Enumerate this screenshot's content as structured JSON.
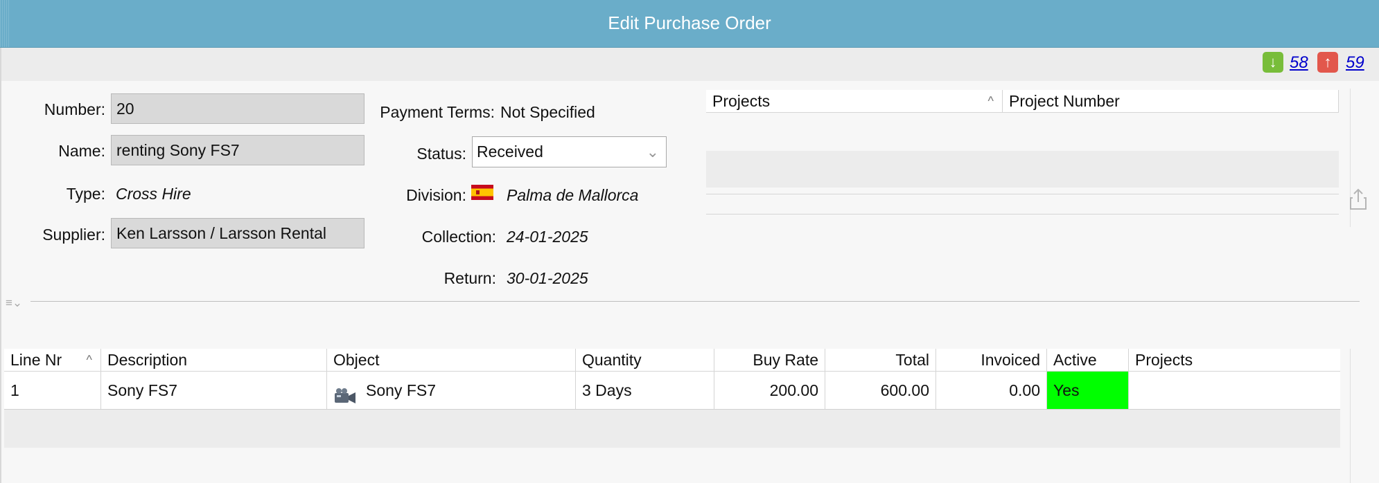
{
  "window": {
    "title": "Edit Purchase Order"
  },
  "nav": {
    "prev_label": "58",
    "next_label": "59"
  },
  "form": {
    "number_label": "Number:",
    "number_value": "20",
    "name_label": "Name:",
    "name_value": "renting Sony FS7",
    "type_label": "Type:",
    "type_value": "Cross Hire",
    "supplier_label": "Supplier:",
    "supplier_value": "Ken Larsson / Larsson Rental",
    "payment_terms_label": "Payment Terms:",
    "payment_terms_value": "Not Specified",
    "status_label": "Status:",
    "status_value": "Received",
    "division_label": "Division:",
    "division_value": "Palma de Mallorca",
    "collection_label": "Collection:",
    "collection_value": "24-01-2025",
    "return_label": "Return:",
    "return_value": "30-01-2025"
  },
  "projects_table": {
    "columns": [
      "Projects",
      "Project Number"
    ]
  },
  "lines_table": {
    "columns": [
      "Line Nr",
      "Description",
      "Object",
      "Quantity",
      "Buy Rate",
      "Total",
      "Invoiced",
      "Active",
      "Projects"
    ],
    "rows": [
      {
        "line_nr": "1",
        "description": "Sony FS7",
        "object": "Sony FS7",
        "quantity": "3 Days",
        "buy_rate": "200.00",
        "total": "600.00",
        "invoiced": "0.00",
        "active": "Yes",
        "projects": ""
      }
    ]
  },
  "colors": {
    "title_bar": "#6aadc9",
    "active_yes": "#00ff00",
    "nav_down": "#78bd3a",
    "nav_up": "#e2574c"
  }
}
